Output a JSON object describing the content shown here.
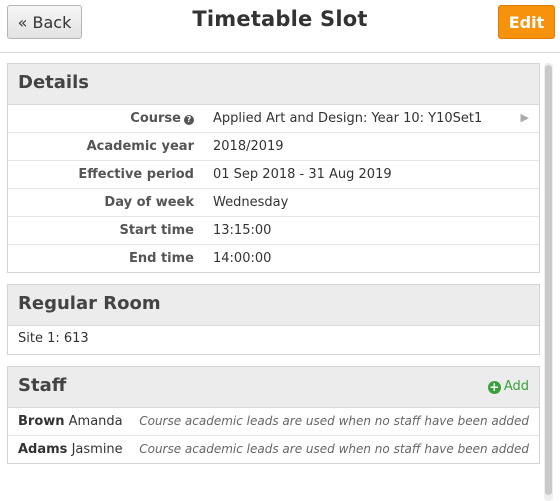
{
  "header": {
    "back_label": "« Back",
    "title": "Timetable Slot",
    "edit_label": "Edit"
  },
  "details": {
    "title": "Details",
    "rows": [
      {
        "label": "Course",
        "value": "Applied Art and Design: Year 10: Y10Set1",
        "has_help": true,
        "has_arrow": true
      },
      {
        "label": "Academic year",
        "value": "2018/2019"
      },
      {
        "label": "Effective period",
        "value": "01 Sep 2018 - 31 Aug 2019"
      },
      {
        "label": "Day of week",
        "value": "Wednesday"
      },
      {
        "label": "Start time",
        "value": "13:15:00"
      },
      {
        "label": "End time",
        "value": "14:00:00"
      }
    ]
  },
  "room": {
    "title": "Regular Room",
    "value": "Site 1: 613"
  },
  "staff": {
    "title": "Staff",
    "add_label": "Add",
    "rows": [
      {
        "surname": "Brown",
        "forename": "Amanda",
        "note": "Course academic leads are used when no staff have been added"
      },
      {
        "surname": "Adams",
        "forename": "Jasmine",
        "note": "Course academic leads are used when no staff have been added"
      }
    ]
  },
  "colors": {
    "accent_orange": "#f7920c",
    "add_green": "#3aa03a"
  }
}
